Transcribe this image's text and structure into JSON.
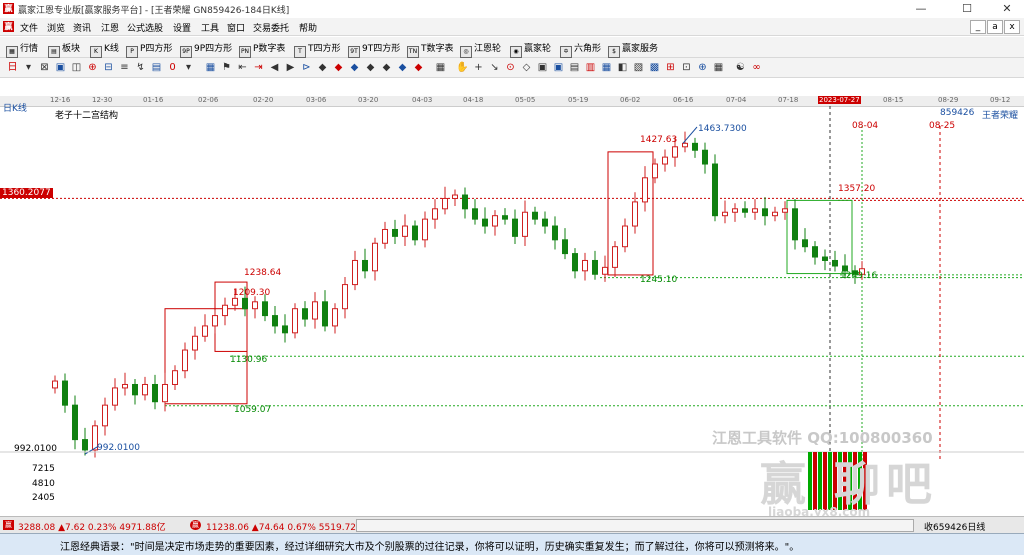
{
  "window": {
    "title": "赢家江恩专业版[赢家服务平台] - [王者荣耀 GN859426-184日K线]",
    "logo_char": "赢",
    "btn_min": "—",
    "btn_max": "☐",
    "btn_close": "✕"
  },
  "menu": {
    "items": [
      "文件",
      "浏览",
      "资讯",
      "江恩",
      "公式选股",
      "设置",
      "工具",
      "窗口",
      "交易委托",
      "帮助"
    ],
    "mdi": [
      "_",
      "a",
      "x"
    ]
  },
  "toolbar1": {
    "items": [
      "行情",
      "板块",
      "K线",
      "P四方形",
      "9P四方形",
      "P数字表",
      "T四方形",
      "9T四方形",
      "T数字表",
      "江恩轮",
      "赢家轮",
      "六角形",
      "赢家服务"
    ],
    "icons": [
      "▦",
      "▤",
      "K",
      "P",
      "9P",
      "PN",
      "T",
      "9T",
      "TN",
      "◎",
      "◉",
      "✡",
      "$"
    ]
  },
  "toolbar2": {
    "glyphs": [
      "日",
      "▾",
      "⊠",
      "▣",
      "◫",
      "⊕",
      "⊟",
      "≡",
      "↯",
      "▤",
      "0",
      "▾",
      "▦",
      "⚑",
      "⇤",
      "⇥",
      "◀",
      "▶",
      "⊳",
      "◆",
      "◆",
      "◆",
      "◆",
      "◆",
      "◆",
      "◆",
      "▦",
      "✋",
      "+",
      "↘",
      "⊙",
      "◇",
      "▣",
      "▣",
      "▤",
      "▥",
      "▦",
      "◧",
      "▧",
      "▩",
      "⊞",
      "⊡",
      "⊕",
      "▦",
      "☯",
      "∞"
    ]
  },
  "axis": {
    "dates": [
      "12-16",
      "12-30",
      "01-16",
      "02-06",
      "02-20",
      "03-06",
      "03-20",
      "04-03",
      "04-18",
      "05-05",
      "05-19",
      "06-02",
      "06-16",
      "07-04",
      "07-18",
      "2023-07-27",
      "08-15",
      "08-29",
      "09-12"
    ],
    "left_title": "日K线",
    "sub_title": "老子十二宫结构",
    "top_right": "859426",
    "top_right_name": "王者荣耀",
    "price_marker": "1360.2077",
    "low_price": "992.0100",
    "vol_ticks": [
      "7215",
      "4810",
      "2405"
    ]
  },
  "annotations": {
    "high1": "1463.7300",
    "p1427": "1427.63",
    "p1357": "1357.20",
    "p1249": "1249.16",
    "p1245": "1245.10",
    "p1238": "1238.64",
    "p1209": "1209.30",
    "p1130": "1130.96",
    "p1059": "1059.07",
    "low1": "992.0100",
    "d0804": "08-04",
    "d0825": "08-25"
  },
  "watermark": {
    "line1": "江恩工具软件  QQ:100800360",
    "big": "赢    聊吧",
    "url": "liaoba.yx8.com"
  },
  "status": {
    "sh": "3288.08 ▲7.62 0.23% 4971.88亿",
    "sz": "11238.06 ▲74.64 0.67% 5519.72亿",
    "right": "收659426日线"
  },
  "quote": "江恩经典语录：\"时间是决定市场走势的重要因素，经过详细研究大市及个别股票的过往记录，你将可以证明，历史确实重复发生；而了解过往，你将可以预测将来。\"。",
  "chart_data": {
    "type": "candlestick",
    "symbol": "GN859426",
    "name": "王者荣耀",
    "period": "日K线",
    "x": [
      "12-16",
      "12-30",
      "01-16",
      "02-06",
      "02-20",
      "03-06",
      "03-20",
      "04-03",
      "04-18",
      "05-05",
      "05-19",
      "06-02",
      "06-16",
      "07-04",
      "07-18",
      "2023-07-27",
      "08-15",
      "08-29",
      "09-12"
    ],
    "ylim": [
      992.01,
      1463.73
    ],
    "levels": [
      1463.73,
      1427.63,
      1360.2077,
      1357.2,
      1249.16,
      1245.1,
      1238.64,
      1209.3,
      1130.96,
      1059.07,
      992.01
    ],
    "high": 1463.73,
    "low": 992.01,
    "colors": {
      "up": "#d02020",
      "down": "#108010",
      "box": "#d02020"
    }
  }
}
